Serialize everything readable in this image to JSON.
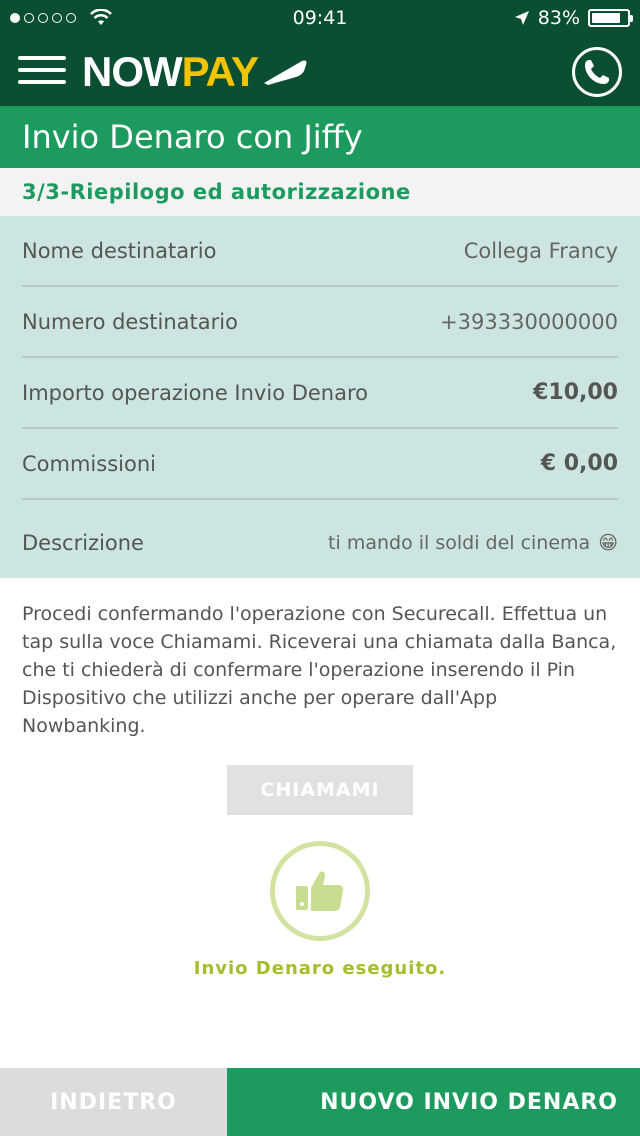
{
  "status_bar": {
    "time": "09:41",
    "battery_text": "83%",
    "battery_level": 0.83,
    "signal_bars_filled": 1,
    "signal_bars_total": 5
  },
  "header": {
    "logo_now": "NOW",
    "logo_pay": "PAY",
    "brand_color": "#0b4f32",
    "logo_accent": "#f2c300"
  },
  "title": "Invio Denaro con Jiffy",
  "step": "3/3-Riepilogo ed autorizzazione",
  "summary": {
    "rows": [
      {
        "label": "Nome destinatario",
        "value": "Collega Francy"
      },
      {
        "label": "Numero destinatario",
        "value": "+393330000000"
      },
      {
        "label": "Importo operazione Invio Denaro",
        "value": "€10,00"
      },
      {
        "label": "Commissioni",
        "value": "€ 0,00"
      },
      {
        "label": "Descrizione",
        "value": "ti mando il soldi del cinema",
        "emoji": "😁"
      }
    ]
  },
  "info_text": "Procedi confermando l'operazione con Securecall. Effettua un tap sulla voce Chiamami. Riceverai una chiamata dalla Banca, che ti chiederà di confermare l'operazione inserendo il Pin Dispositivo che utilizzi anche per operare dall'App Nowbanking.",
  "call_button": "CHIAMAMI",
  "success_message": "Invio Denaro eseguito.",
  "footer": {
    "back_label": "INDIETRO",
    "new_label": "NUOVO INVIO DENARO"
  },
  "colors": {
    "primary_green": "#1d9a5d",
    "summary_bg": "#cde5e1",
    "success_lime": "#a4be2d"
  }
}
